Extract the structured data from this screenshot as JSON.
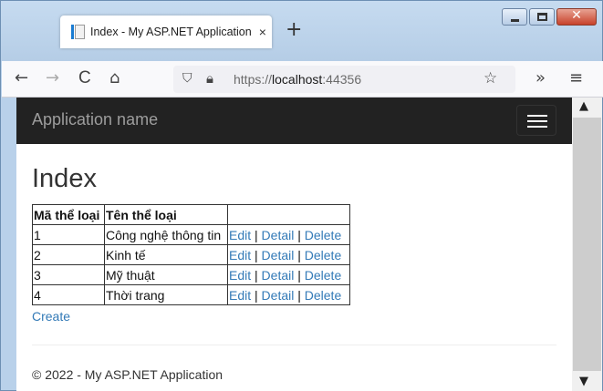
{
  "browser": {
    "tab_title": "Index - My ASP.NET Application",
    "tab_close": "×",
    "new_tab": "+",
    "url_prefix": "https://",
    "url_host": "localhost",
    "url_port": ":44356",
    "back": "←",
    "forward": "→",
    "reload": "C",
    "home": "⌂",
    "shield": "⛉",
    "star": "☆",
    "overflow": "»",
    "menu": "≡"
  },
  "app": {
    "brand": "Application name",
    "page_title": "Index",
    "table": {
      "headers": [
        "Mã thể loại",
        "Tên thể loại",
        ""
      ],
      "rows": [
        {
          "id": "1",
          "name": "Công nghệ thông tin"
        },
        {
          "id": "2",
          "name": "Kinh tế"
        },
        {
          "id": "3",
          "name": "Mỹ thuật"
        },
        {
          "id": "4",
          "name": "Thời trang"
        }
      ],
      "actions": {
        "edit": "Edit",
        "detail": "Detail",
        "delete": "Delete",
        "separator": "|"
      }
    },
    "create_label": "Create",
    "footer": "© 2022 - My ASP.NET Application"
  },
  "colors": {
    "navbar_bg": "#222222",
    "link": "#337ab7"
  },
  "icons": {
    "tab": "page-icon",
    "hamburger": "hamburger-icon",
    "lock": "lock-icon"
  }
}
